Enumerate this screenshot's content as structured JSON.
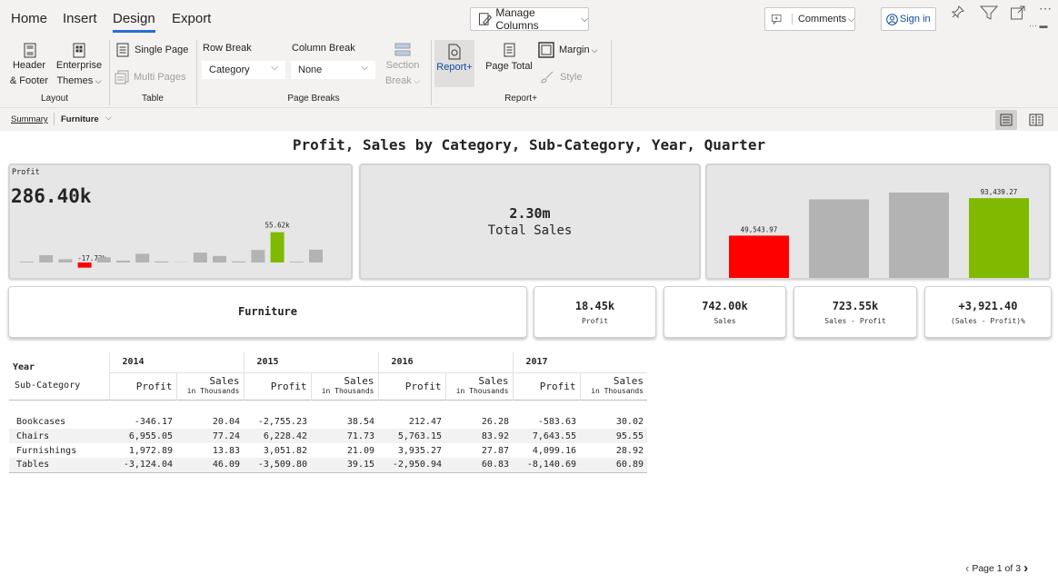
{
  "ribbon": {
    "tabs": [
      "Home",
      "Insert",
      "Design",
      "Export"
    ],
    "manage_columns": "Manage Columns",
    "comments": "Comments",
    "sign_in": "Sign in",
    "header_footer": [
      "Header",
      "& Footer"
    ],
    "enterprise_themes": [
      "Enterprise",
      "Themes"
    ],
    "single_page": "Single Page",
    "multi_pages": "Multi Pages",
    "row_break": "Row Break",
    "row_break_value": "Category",
    "column_break": "Column Break",
    "column_break_value": "None",
    "section_break": [
      "Section",
      "Break"
    ],
    "report_plus": "Report+",
    "page_total": "Page Total",
    "margin": "Margin",
    "style": "Style",
    "groups": [
      "Layout",
      "Table",
      "Page Breaks",
      "Report+"
    ]
  },
  "breadcrumb": {
    "root": "Summary",
    "current": "Furniture"
  },
  "report": {
    "title": "Profit, Sales by Category, Sub-Category, Year, Quarter",
    "profit_card": {
      "label": "Profit",
      "value": "286.40k",
      "high_label": "55.62k",
      "low_label": "-17.73k"
    },
    "sales_card": {
      "value": "2.30m",
      "label": "Total Sales"
    },
    "bar_card": {
      "low_label": "49,543.97",
      "high_label": "93,439.27"
    },
    "category": "Furniture",
    "kpis": [
      {
        "value": "18.45k",
        "label": "Profit"
      },
      {
        "value": "742.00k",
        "label": "Sales"
      },
      {
        "value": "723.55k",
        "label": "Sales - Profit"
      },
      {
        "value": "+3,921.40",
        "label": "(Sales - Profit)%"
      }
    ],
    "table": {
      "year_label": "Year",
      "subcat_label": "Sub-Category",
      "years": [
        "2014",
        "2015",
        "2016",
        "2017"
      ],
      "profit_label": "Profit",
      "sales_label": "Sales",
      "sales_sub": "in Thousands",
      "rows": [
        {
          "name": "Bookcases",
          "cells": [
            "-346.17",
            "20.04",
            "-2,755.23",
            "38.54",
            "212.47",
            "26.28",
            "-583.63",
            "30.02"
          ]
        },
        {
          "name": "Chairs",
          "cells": [
            "6,955.05",
            "77.24",
            "6,228.42",
            "71.73",
            "5,763.15",
            "83.92",
            "7,643.55",
            "95.55"
          ]
        },
        {
          "name": "Furnishings",
          "cells": [
            "1,972.89",
            "13.83",
            "3,051.82",
            "21.09",
            "3,935.27",
            "27.87",
            "4,099.16",
            "28.92"
          ]
        },
        {
          "name": "Tables",
          "cells": [
            "-3,124.04",
            "46.09",
            "-3,509.80",
            "39.15",
            "-2,950.94",
            "60.83",
            "-8,140.69",
            "60.89"
          ]
        }
      ]
    },
    "pager": {
      "text": "Page 1 of 3"
    }
  },
  "chart_data": [
    {
      "type": "bar",
      "categories": [
        "1",
        "2",
        "3",
        "4",
        "5",
        "6",
        "7",
        "8",
        "9",
        "10",
        "11",
        "12",
        "13",
        "14",
        "15",
        "16"
      ],
      "values": [
        1.5,
        13.5,
        6,
        -9.5,
        9.5,
        3.5,
        16,
        2,
        0.5,
        18,
        12,
        2,
        23,
        55.62,
        1.5,
        23.5
      ],
      "highlight": {
        "min_index": 3,
        "max_index": 13,
        "min_label": "-17.73k",
        "max_label": "55.62k"
      },
      "colors": {
        "base": "#b3b3b3",
        "low": "#ff0000",
        "high": "#7fba00"
      }
    },
    {
      "type": "bar",
      "categories": [
        "1",
        "2",
        "3",
        "4"
      ],
      "values": [
        49543.97,
        92000,
        100000,
        93439.27
      ],
      "labels": [
        "49,543.97",
        "",
        "",
        "93,439.27"
      ],
      "colors": [
        "#ff0000",
        "#b3b3b3",
        "#b3b3b3",
        "#7fba00"
      ]
    }
  ]
}
